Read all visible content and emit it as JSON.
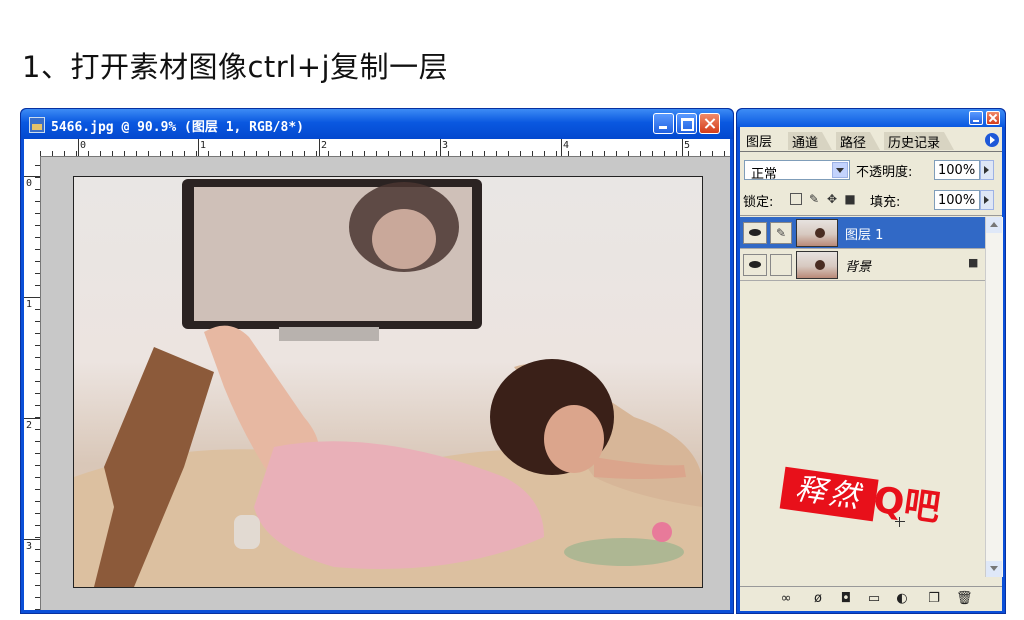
{
  "heading": "1、打开素材图像ctrl+j复制一层",
  "document_window": {
    "title": "5466.jpg @ 90.9% (图层 1, RGB/8*)",
    "ruler_h_numbers": [
      "0",
      "1",
      "2",
      "3",
      "4",
      "5"
    ],
    "ruler_v_numbers": [
      "0",
      "1",
      "2",
      "3"
    ]
  },
  "layers_panel": {
    "tabs": [
      "图层",
      "通道",
      "路径",
      "历史记录"
    ],
    "blend_mode": "正常",
    "opacity_label": "不透明度:",
    "opacity_value": "100%",
    "lock_label": "锁定:",
    "fill_label": "填充:",
    "fill_value": "100%",
    "layers": [
      {
        "name": "图层 1",
        "selected": true
      },
      {
        "name": "背景",
        "selected": false,
        "locked": true
      }
    ],
    "watermark": {
      "boxed_text": "释然",
      "tail_text": "Q吧"
    },
    "bottom_icons": [
      "link-icon",
      "layer-style-icon",
      "mask-icon",
      "new-set-icon",
      "adjustment-icon",
      "new-layer-icon",
      "trash-icon"
    ]
  },
  "colors": {
    "titlebar_blue": "#0a58e0",
    "selection_blue": "#3169c6",
    "watermark_red": "#e8101a"
  }
}
